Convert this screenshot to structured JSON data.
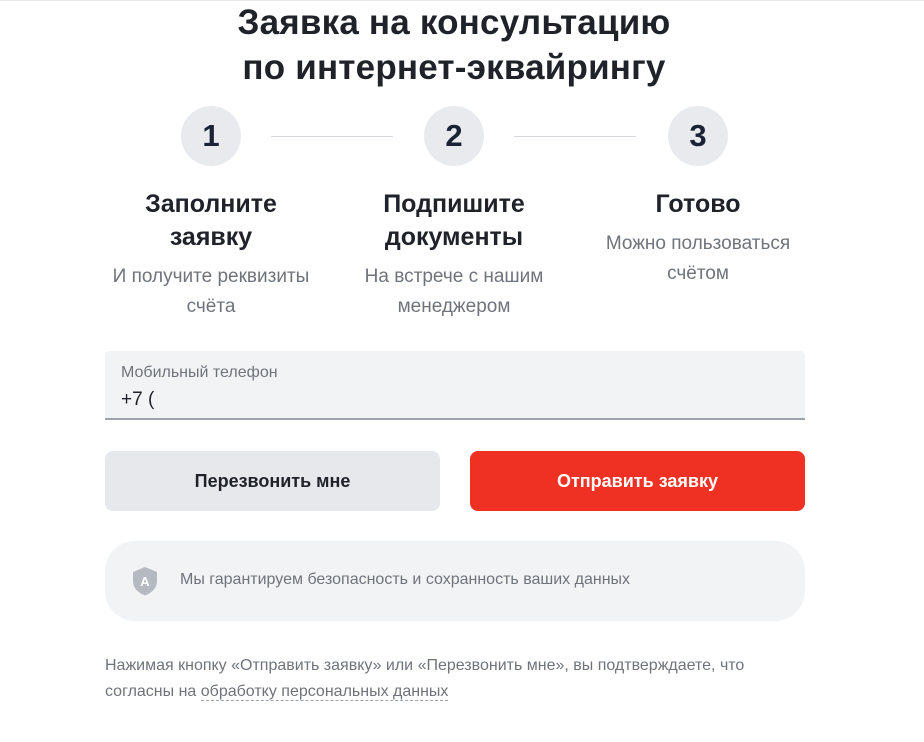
{
  "header": {
    "title_line1": "Заявка на консультацию",
    "title_line2": "по интернет-эквайрингу"
  },
  "steps": [
    {
      "number": "1",
      "title_line1": "Заполните",
      "title_line2": "заявку",
      "desc_line1": "И получите реквизиты",
      "desc_line2": "счёта"
    },
    {
      "number": "2",
      "title_line1": "Подпишите",
      "title_line2": "документы",
      "desc_line1": "На встрече с нашим",
      "desc_line2": "менеджером"
    },
    {
      "number": "3",
      "title_line1": "Готово",
      "desc_line1": "Можно пользоваться",
      "desc_line2": "счётом"
    }
  ],
  "form": {
    "phone_label": "Мобильный телефон",
    "phone_value": "+7 ("
  },
  "buttons": {
    "callback_label": "Перезвонить мне",
    "submit_label": "Отправить заявку"
  },
  "security": {
    "icon": "shield-icon",
    "icon_letter": "А",
    "text": "Мы гарантируем безопасность и сохранность ваших данных"
  },
  "disclaimer": {
    "text_line1": "Нажимая кнопку «Отправить заявку» или «Перезвонить мне», вы подтверждаете, что",
    "text_line2_prefix": "согласны на ",
    "link_text": "обработку персональных данных"
  },
  "colors": {
    "accent": "#ef3124",
    "secondary_button": "#e6e8ec",
    "field_background": "#f2f3f5",
    "muted_text": "#6f737b",
    "step_circle": "#e8eaee"
  }
}
